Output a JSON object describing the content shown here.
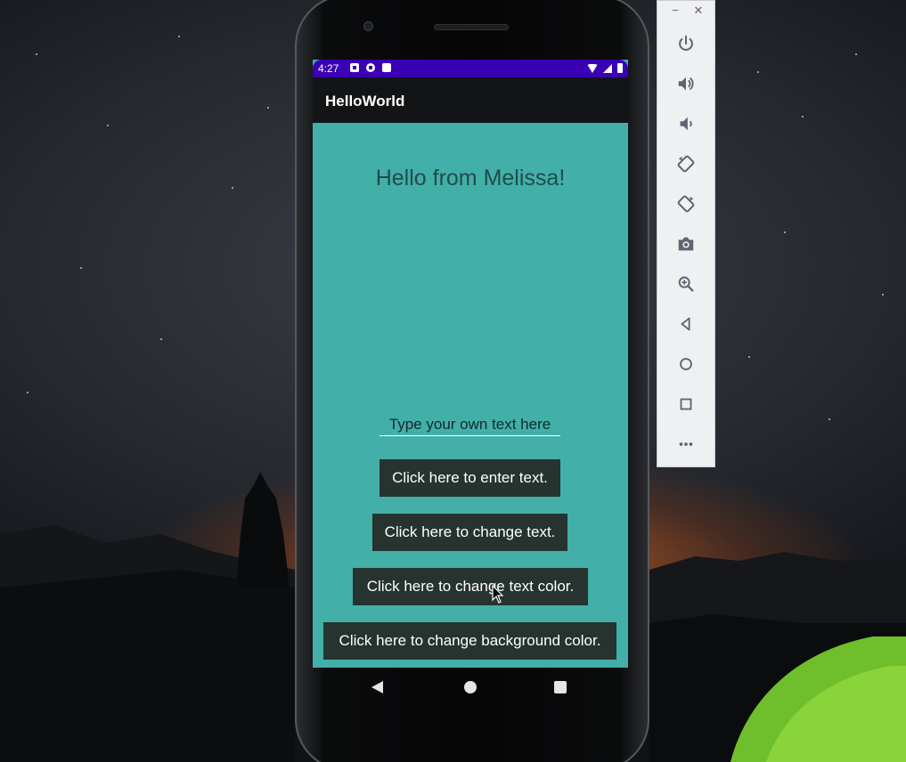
{
  "status_bar": {
    "time": "4:27"
  },
  "app_bar": {
    "title": "HelloWorld"
  },
  "main": {
    "greeting": "Hello from Melissa!",
    "text_input": {
      "placeholder": "Type your own text here",
      "value": ""
    },
    "buttons": [
      {
        "label": "Click here to enter text."
      },
      {
        "label": "Click here to change text."
      },
      {
        "label": "Click here to change text color."
      },
      {
        "label": "Click here to change background color."
      }
    ]
  },
  "navigation": [
    "back-icon",
    "home-icon",
    "recents-icon"
  ],
  "emulator_toolbar": {
    "window_controls": {
      "minimize": "−",
      "close": "✕"
    },
    "buttons": [
      "power-icon",
      "volume-up-icon",
      "volume-down-icon",
      "rotate-left-icon",
      "rotate-right-icon",
      "camera-icon",
      "zoom-icon",
      "back-icon",
      "home-icon",
      "overview-icon",
      "more-icon"
    ]
  },
  "colors": {
    "app_background": "#42afa9",
    "status_bar": "#3a00b3",
    "app_bar": "#121416",
    "button": "#26332f",
    "greeting_text": "#1f4c4a"
  }
}
